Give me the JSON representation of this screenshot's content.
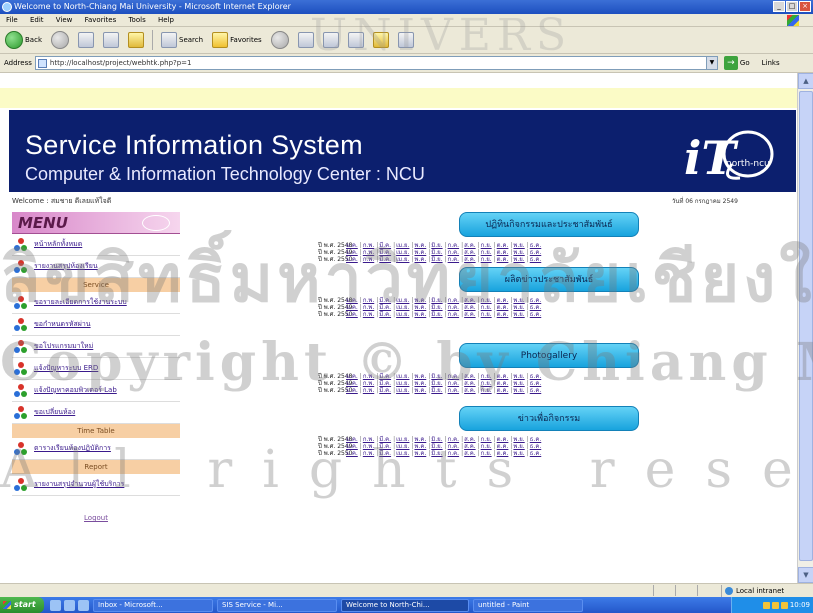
{
  "window": {
    "title": "Welcome to North-Chiang Mai University - Microsoft Internet Explorer",
    "controls": [
      "_",
      "□",
      "×"
    ]
  },
  "menubar": [
    "File",
    "Edit",
    "View",
    "Favorites",
    "Tools",
    "Help"
  ],
  "toolbar": {
    "back_label": "Back",
    "search_label": "Search",
    "favorites_label": "Favorites"
  },
  "addressbar": {
    "label": "Address",
    "url": "http://localhost/project/webhtk.php?p=1",
    "go_label": "Go",
    "links_label": "Links"
  },
  "banner": {
    "title": "Service Information System",
    "subtitle": "Computer & Information Technology Center : NCU",
    "logo_text": "north-ncu"
  },
  "welcome": "Welcome : สมชาย ดีเลยแท้ใจดี",
  "date": "วันที่ 06 กรกฎาคม 2549",
  "sidebar": {
    "menu_title": "MENU",
    "items_top": [
      "หน้าหลักทั้งหมด",
      "รายงานสรุปห้องเรียน"
    ],
    "section1": "Service",
    "items_service": [
      "ขอรายละเอียดการใช้งานระบบ",
      "ขอกำหนดรหัสผ่าน",
      "ขอโปรแกรมมาใหม่",
      "แจ้งปัญหาระบบ ERD",
      "แจ้งปัญหาคอมพิวเตอร์ Lab",
      "ขอเปลี่ยนห้อง"
    ],
    "section2": "Time Table",
    "items_timetable": [
      "ตารางเรียนห้องปฏิบัติการ"
    ],
    "section3": "Report",
    "items_report": [
      "รายงานสรุปจำนวนผู้ใช้บริการ"
    ],
    "logout": "Logout"
  },
  "main": {
    "sections": [
      {
        "title": "ปฏิทินกิจกรรมและประชาสัมพันธ์",
        "rows": [
          {
            "year": "ปี พ.ศ. 2548",
            "months": [
              "ม.ค.",
              "ก.พ.",
              "มี.ค.",
              "เม.ย.",
              "พ.ค.",
              "มิ.ย.",
              "ก.ค.",
              "ส.ค.",
              "ก.ย.",
              "ต.ค.",
              "พ.ย.",
              "ธ.ค."
            ]
          },
          {
            "year": "ปี พ.ศ. 2549",
            "months": [
              "ม.ค.",
              "ก.พ.",
              "มี.ค.",
              "เม.ย.",
              "พ.ค.",
              "มิ.ย.",
              "ก.ค.",
              "ส.ค.",
              "ก.ย.",
              "ต.ค.",
              "พ.ย.",
              "ธ.ค."
            ]
          },
          {
            "year": "ปี พ.ศ. 2550",
            "months": [
              "ม.ค.",
              "ก.พ.",
              "มี.ค.",
              "เม.ย.",
              "พ.ค.",
              "มิ.ย.",
              "ก.ค.",
              "ส.ค.",
              "ก.ย.",
              "ต.ค.",
              "พ.ย.",
              "ธ.ค."
            ]
          }
        ]
      },
      {
        "title": "ผลิตข่าวประชาสัมพันธ์",
        "rows": [
          {
            "year": "ปี พ.ศ. 2548",
            "months": [
              "ม.ค.",
              "ก.พ.",
              "มี.ค.",
              "เม.ย.",
              "พ.ค.",
              "มิ.ย.",
              "ก.ค.",
              "ส.ค.",
              "ก.ย.",
              "ต.ค.",
              "พ.ย.",
              "ธ.ค."
            ]
          },
          {
            "year": "ปี พ.ศ. 2549",
            "months": [
              "ม.ค.",
              "ก.พ.",
              "มี.ค.",
              "เม.ย.",
              "พ.ค.",
              "มิ.ย.",
              "ก.ค.",
              "ส.ค.",
              "ก.ย.",
              "ต.ค.",
              "พ.ย.",
              "ธ.ค."
            ]
          },
          {
            "year": "ปี พ.ศ. 2550",
            "months": [
              "ม.ค.",
              "ก.พ.",
              "มี.ค.",
              "เม.ย.",
              "พ.ค.",
              "มิ.ย.",
              "ก.ค.",
              "ส.ค.",
              "ก.ย.",
              "ต.ค.",
              "พ.ย.",
              "ธ.ค."
            ]
          }
        ]
      },
      {
        "title": "Photogallery",
        "rows": [
          {
            "year": "ปี พ.ศ. 2548",
            "months": [
              "ม.ค.",
              "ก.พ.",
              "มี.ค.",
              "เม.ย.",
              "พ.ค.",
              "มิ.ย.",
              "ก.ค.",
              "ส.ค.",
              "ก.ย.",
              "ต.ค.",
              "พ.ย.",
              "ธ.ค."
            ]
          },
          {
            "year": "ปี พ.ศ. 2549",
            "months": [
              "ม.ค.",
              "ก.พ.",
              "มี.ค.",
              "เม.ย.",
              "พ.ค.",
              "มิ.ย.",
              "ก.ค.",
              "ส.ค.",
              "ก.ย.",
              "ต.ค.",
              "พ.ย.",
              "ธ.ค."
            ]
          },
          {
            "year": "ปี พ.ศ. 2550",
            "months": [
              "ม.ค.",
              "ก.พ.",
              "มี.ค.",
              "เม.ย.",
              "พ.ค.",
              "มิ.ย.",
              "ก.ค.",
              "ส.ค.",
              "ก.ย.",
              "ต.ค.",
              "พ.ย.",
              "ธ.ค."
            ]
          }
        ]
      },
      {
        "title": "ข่าวเพื่อกิจกรรม",
        "rows": [
          {
            "year": "ปี พ.ศ. 2548",
            "months": [
              "ม.ค.",
              "ก.พ.",
              "มี.ค.",
              "เม.ย.",
              "พ.ค.",
              "มิ.ย.",
              "ก.ค.",
              "ส.ค.",
              "ก.ย.",
              "ต.ค.",
              "พ.ย.",
              "ธ.ค."
            ]
          },
          {
            "year": "ปี พ.ศ. 2549",
            "months": [
              "ม.ค.",
              "ก.พ.",
              "มี.ค.",
              "เม.ย.",
              "พ.ค.",
              "มิ.ย.",
              "ก.ค.",
              "ส.ค.",
              "ก.ย.",
              "ต.ค.",
              "พ.ย.",
              "ธ.ค."
            ]
          },
          {
            "year": "ปี พ.ศ. 2550",
            "months": [
              "ม.ค.",
              "ก.พ.",
              "มี.ค.",
              "เม.ย.",
              "พ.ค.",
              "มิ.ย.",
              "ก.ค.",
              "ส.ค.",
              "ก.ย.",
              "ต.ค.",
              "พ.ย.",
              "ธ.ค."
            ]
          }
        ]
      }
    ]
  },
  "statusbar": {
    "zone": "Local intranet"
  },
  "taskbar": {
    "start": "start",
    "tasks": [
      "Inbox - Microsoft...",
      "SIS Service - Mi...",
      "Welcome to North-Chi...",
      "untitled - Paint"
    ],
    "clock": "10:09"
  },
  "watermark": {
    "line1": "UNIVERS",
    "line2": "ลิขสิทธิ์มหาวิทยาลัยเชียงใหม่",
    "line3": "Copyright © by Chiang Mai University",
    "line4": "All rights reserved"
  },
  "colors": {
    "banner_bg": "#0c1f6e",
    "menu_header": "#d887c9",
    "section_header": "#f7cfa4",
    "section_button": "#18a3dd",
    "link": "#3a1a8c"
  }
}
